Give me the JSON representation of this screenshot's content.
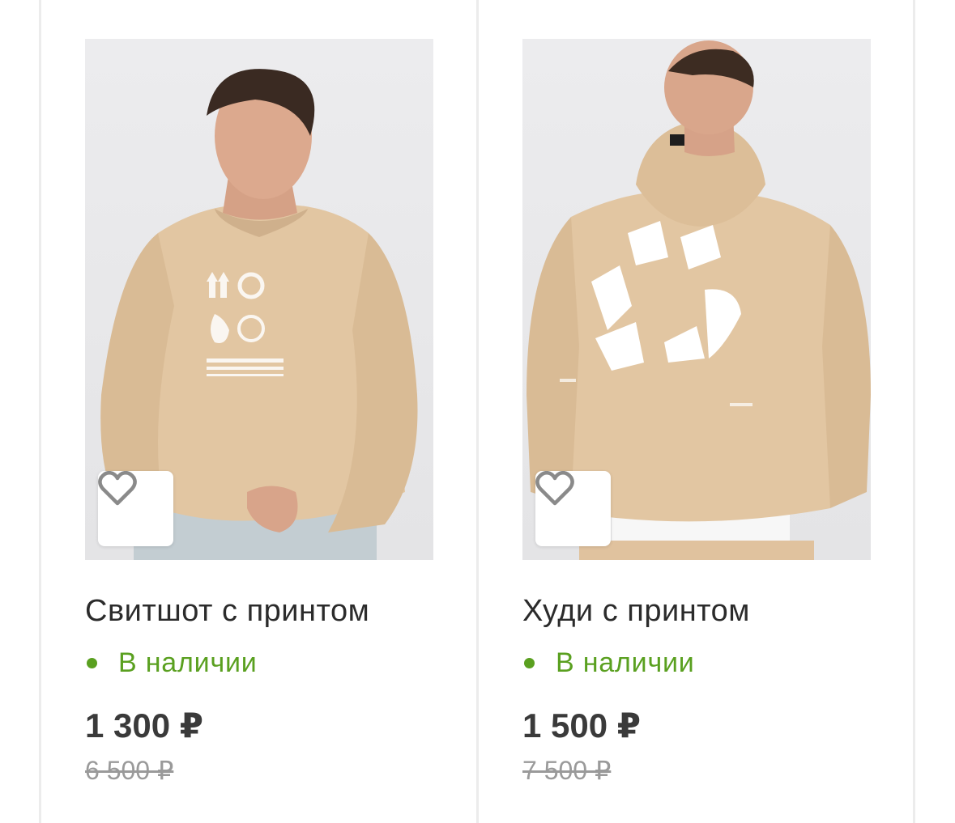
{
  "products": [
    {
      "title": "Свитшот с принтом",
      "availability": "В наличии",
      "price": "1 300 ₽",
      "old_price": "6 500 ₽",
      "image": "product-photo-sweatshirt",
      "favorite_icon": "heart-outline-icon"
    },
    {
      "title": "Худи с принтом",
      "availability": "В наличии",
      "price": "1 500 ₽",
      "old_price": "7 500 ₽",
      "image": "product-photo-hoodie",
      "favorite_icon": "heart-outline-icon"
    }
  ],
  "colors": {
    "availability": "#5aa020",
    "price": "#3a3a3a",
    "old_price": "#9a9a9a",
    "divider": "#ececec",
    "garment": "#e2c6a2"
  }
}
